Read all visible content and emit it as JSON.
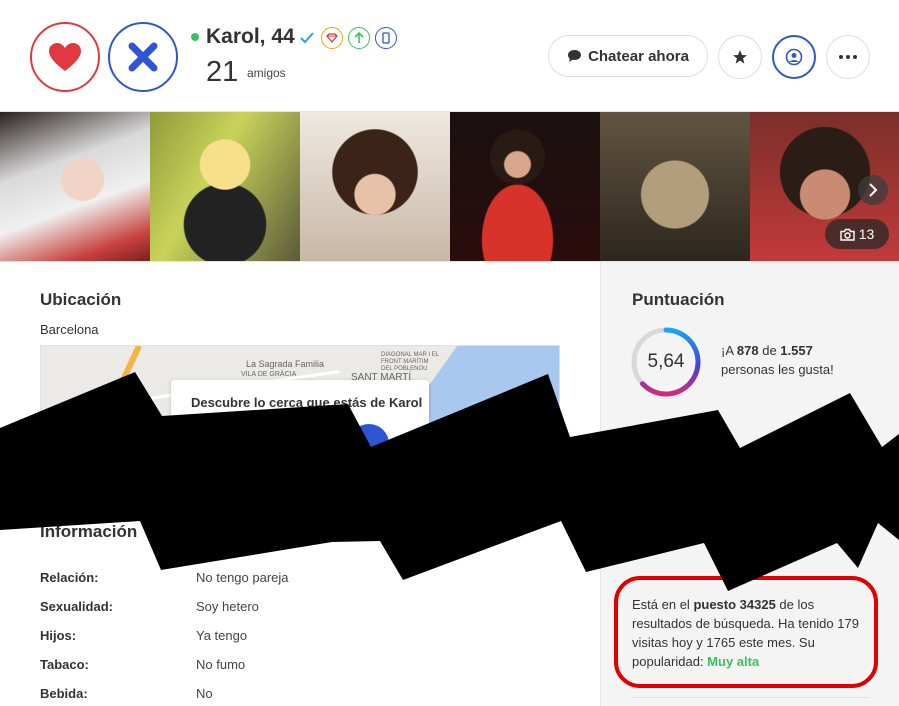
{
  "header": {
    "name": "Karol, 44",
    "friends_count": "21",
    "friends_label": "amigos",
    "chat_label": "Chatear ahora",
    "colors": {
      "like": "#e0393e",
      "nope": "#2d55d4",
      "online": "#3cc25b"
    }
  },
  "photos": {
    "count": "13",
    "icons": [
      "camera-icon",
      "chevron-right-icon"
    ]
  },
  "location": {
    "title": "Ubicación",
    "city": "Barcelona",
    "map_labels": [
      "La Sagrada Familia",
      "VILA DE GRÀCIA",
      "SANT MARTÍ",
      "DIAGONAL MAR I EL FRONT MARÍTIM DEL POBLENOU"
    ],
    "card_text": "Descubre lo cerca que estás de Karol"
  },
  "info": {
    "title": "Información",
    "rows": [
      {
        "key": "Relación:",
        "value": "No tengo pareja"
      },
      {
        "key": "Sexualidad:",
        "value": "Soy hetero"
      },
      {
        "key": "Hijos:",
        "value": "Ya tengo"
      },
      {
        "key": "Tabaco:",
        "value": "No fumo"
      },
      {
        "key": "Bebida:",
        "value": "No"
      }
    ]
  },
  "score": {
    "title": "Puntuación",
    "value": "5,64",
    "likes_prefix": "¡A ",
    "likes": "878",
    "likes_mid": " de ",
    "total": "1.557",
    "likes_suffix": "personas les gusta!"
  },
  "popularity": {
    "prefix": "Está en el ",
    "rank": "puesto 34325",
    "middle": " de los resultados de búsqueda. Ha tenido 179 visitas hoy y 1765 este mes. Su popularidad: ",
    "level": "Muy alta"
  }
}
